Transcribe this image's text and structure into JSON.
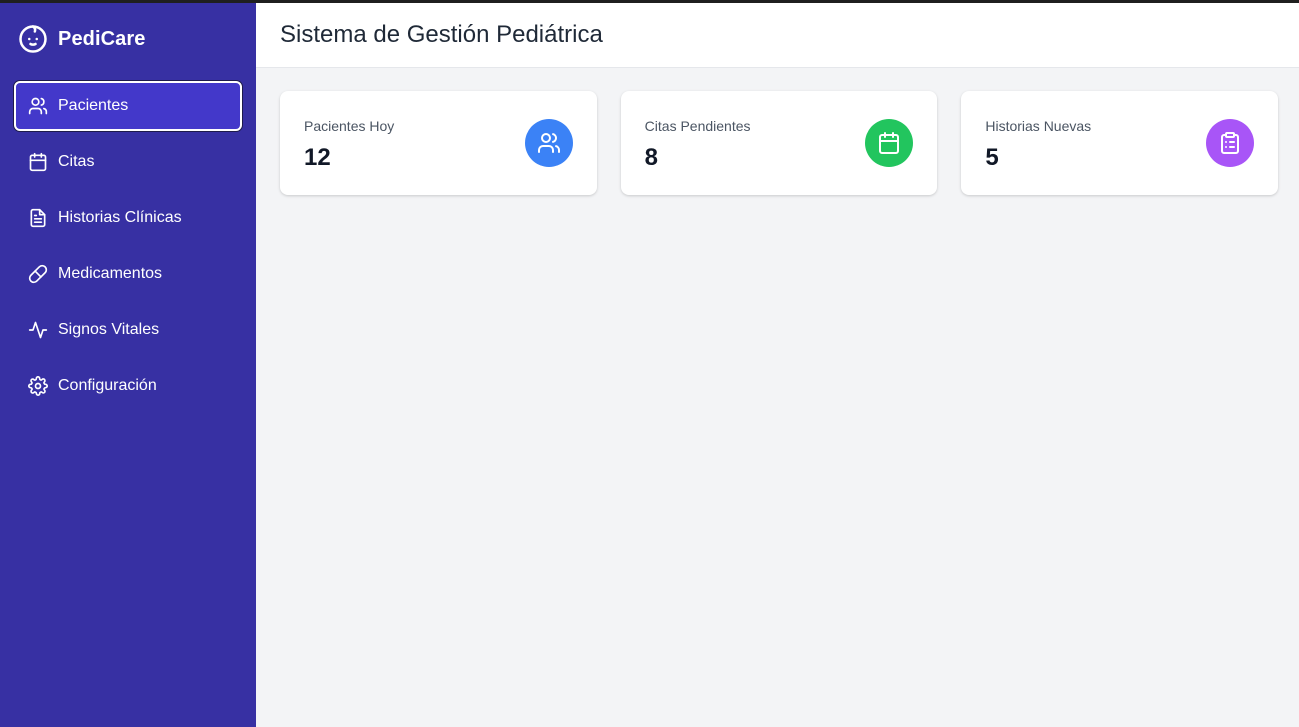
{
  "app": {
    "name": "PediCare",
    "logo_icon": "baby-face-icon"
  },
  "sidebar": {
    "items": [
      {
        "label": "Pacientes",
        "icon": "users-icon",
        "active": true
      },
      {
        "label": "Citas",
        "icon": "calendar-icon",
        "active": false
      },
      {
        "label": "Historias Clínicas",
        "icon": "file-text-icon",
        "active": false
      },
      {
        "label": "Medicamentos",
        "icon": "pill-icon",
        "active": false
      },
      {
        "label": "Signos Vitales",
        "icon": "activity-icon",
        "active": false
      },
      {
        "label": "Configuración",
        "icon": "gear-icon",
        "active": false
      }
    ]
  },
  "header": {
    "title": "Sistema de Gestión Pediátrica"
  },
  "stats": [
    {
      "label": "Pacientes Hoy",
      "value": "12",
      "icon": "users-icon",
      "color": "#3b82f6"
    },
    {
      "label": "Citas Pendientes",
      "value": "8",
      "icon": "calendar-icon",
      "color": "#22c55e"
    },
    {
      "label": "Historias Nuevas",
      "value": "5",
      "icon": "clipboard-list-icon",
      "color": "#a855f7"
    }
  ],
  "colors": {
    "sidebar_bg": "#3730a3",
    "active_item_bg": "#4338ca",
    "content_bg": "#f3f4f6"
  }
}
